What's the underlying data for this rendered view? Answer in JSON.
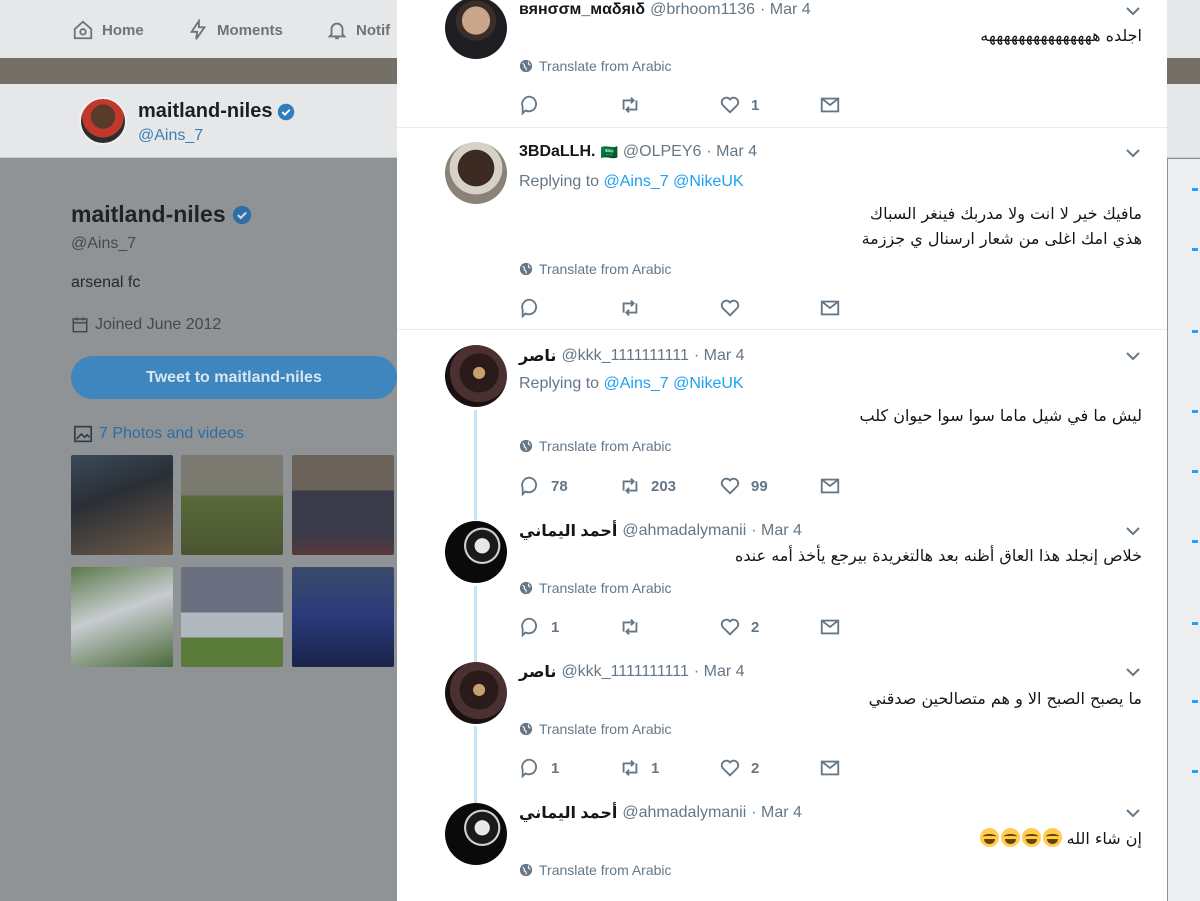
{
  "nav": {
    "home": "Home",
    "moments": "Moments",
    "notifications": "Notif"
  },
  "profile": {
    "name": "maitland-niles",
    "handle": "@Ains_7",
    "bio": "arsenal fc",
    "joined": "Joined June 2012",
    "tweet_to": "Tweet to maitland-niles",
    "photos": "7 Photos and videos"
  },
  "common": {
    "translate": "Translate from Arabic",
    "replying": "Replying to"
  },
  "tweets": [
    {
      "name": "вянσσм_мαδяιδ",
      "handle": "@brhoom1136",
      "date": "· Mar 4",
      "text": "اجلده هههههههههههههههه",
      "reply": "",
      "retweet": "",
      "like": "1"
    },
    {
      "name": "3BDaLLH.",
      "flag": "🇸🇦",
      "handle": "@OLPEY6",
      "date": "· Mar 4",
      "mentions": [
        "@Ains_7",
        "@NikeUK"
      ],
      "text": "مافيك خير لا انت ولا مدربك فينغر السباك",
      "text2": "هذي امك اغلى من شعار ارسنال ي جززمة",
      "reply": "",
      "retweet": "",
      "like": ""
    },
    {
      "name": "ناصر",
      "handle": "@kkk_1111111111",
      "date": "· Mar 4",
      "mentions": [
        "@Ains_7",
        "@NikeUK"
      ],
      "text": "ليش ما في شيل ماما سوا سوا حيوان كلب",
      "reply": "78",
      "retweet": "203",
      "like": "99"
    },
    {
      "name": "أحمد اليماني",
      "handle": "@ahmadalymanii",
      "date": "· Mar 4",
      "text": "خلاص إنجلد هذا العاق أظنه بعد هالتغريدة بيرجع يأخذ أمه عنده",
      "reply": "1",
      "retweet": "",
      "like": "2"
    },
    {
      "name": "ناصر",
      "handle": "@kkk_1111111111",
      "date": "· Mar 4",
      "text": "ما يصبح الصبح الا و هم متصالحين صدقني",
      "reply": "1",
      "retweet": "1",
      "like": "2"
    },
    {
      "name": "أحمد اليماني",
      "handle": "@ahmadalymanii",
      "date": "· Mar 4",
      "text": "إن شاء الله",
      "reply": "",
      "retweet": "",
      "like": ""
    }
  ],
  "icons": {
    "home": "home-icon",
    "moments": "lightning-icon",
    "notifications": "bell-icon",
    "verified": "verified-badge-icon",
    "calendar": "calendar-icon",
    "photos": "image-icon",
    "globe": "globe-icon",
    "reply": "reply-icon",
    "retweet": "retweet-icon",
    "like": "heart-icon",
    "dm": "envelope-icon",
    "caret": "chevron-down-icon",
    "emoji": "laughing-tears-emoji"
  },
  "colors": {
    "link": "#1da1f2",
    "muted": "#657786",
    "text": "#14171a",
    "thread": "#c4e4f8"
  }
}
